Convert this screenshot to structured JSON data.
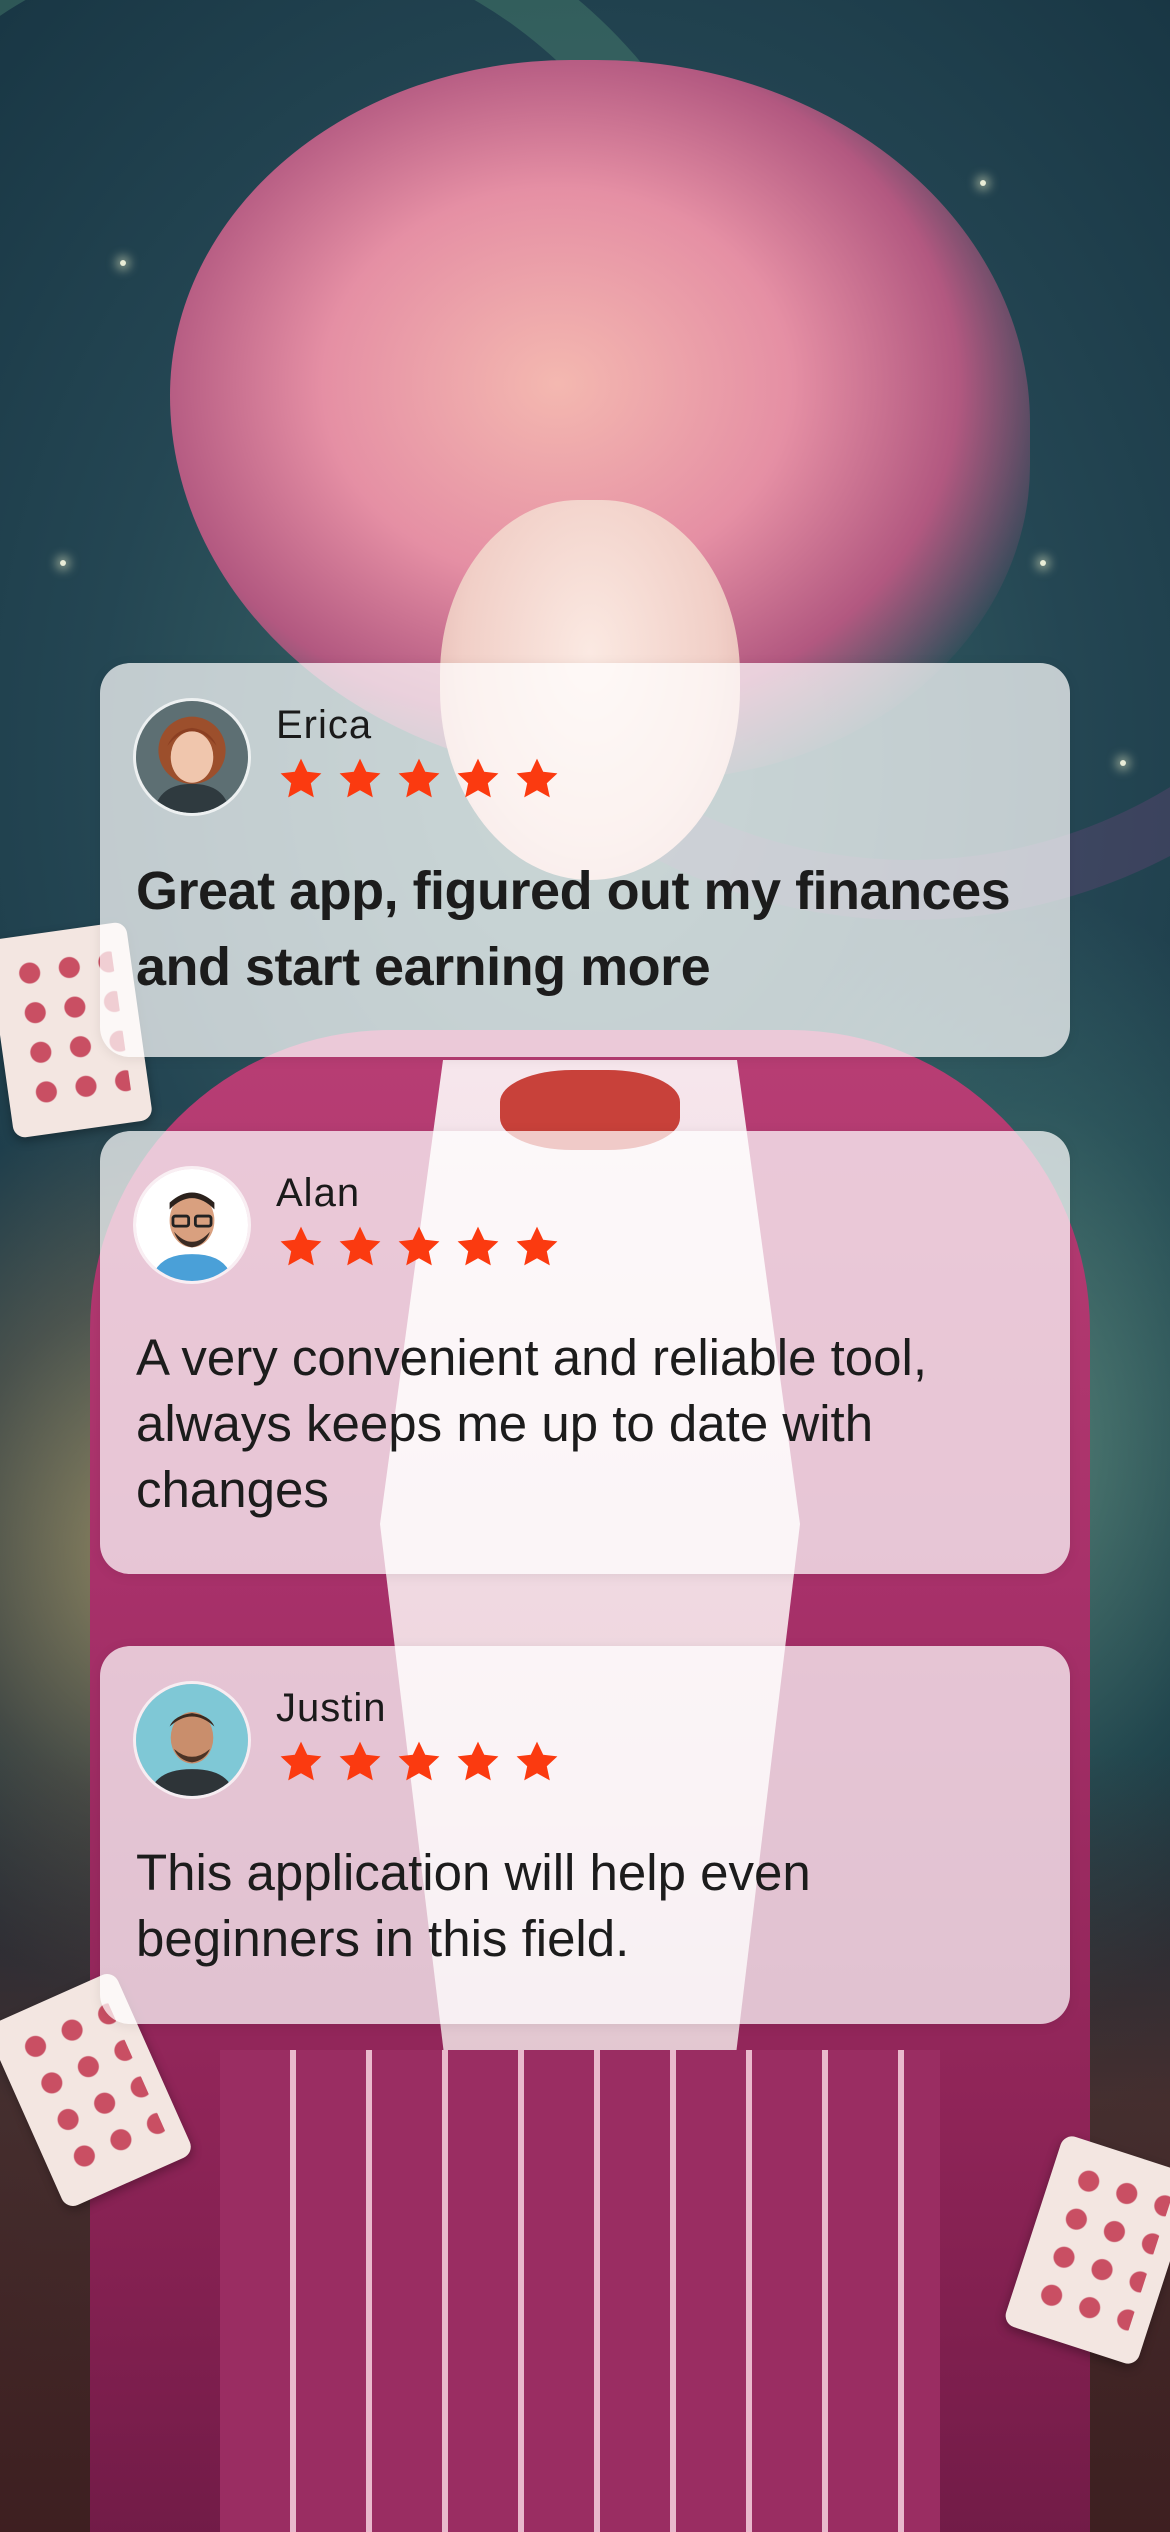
{
  "theme": {
    "card_background": "#ffffffb8",
    "star_color": "#fb3a10",
    "text_color": "#1c1c1c"
  },
  "reviews": [
    {
      "name": "Erica",
      "rating": 5,
      "text": "Great app, figured out my finances and start earning more",
      "avatar_icon": "avatar-erica"
    },
    {
      "name": "Alan",
      "rating": 5,
      "text": "A very convenient and reliable tool, always keeps me up to date with changes",
      "avatar_icon": "avatar-alan"
    },
    {
      "name": "Justin",
      "rating": 5,
      "text": "This application will help even beginners in this field.",
      "avatar_icon": "avatar-justin"
    }
  ]
}
